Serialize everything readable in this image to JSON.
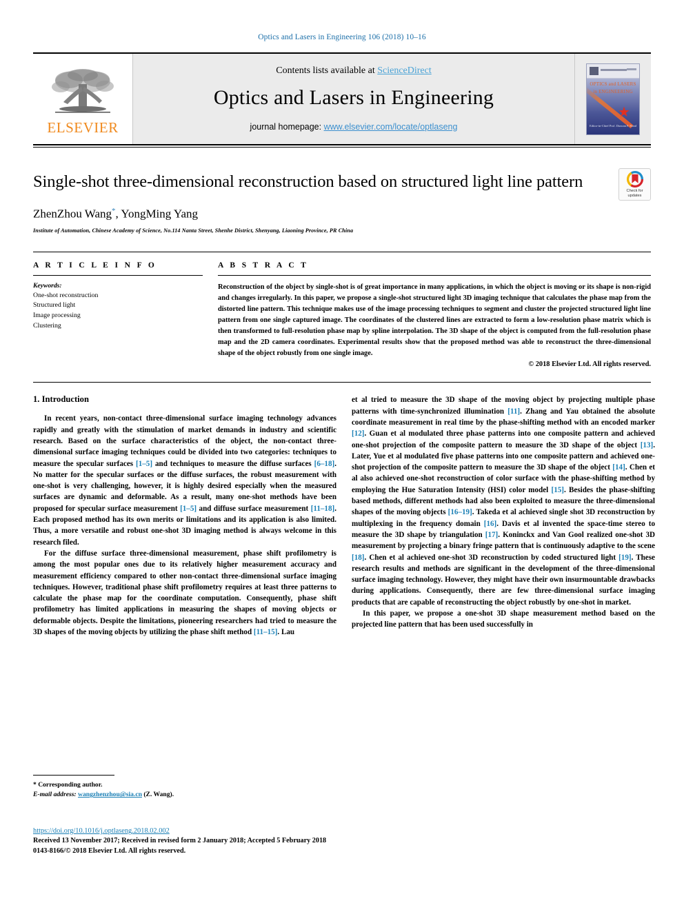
{
  "running_head": "Optics and Lasers in Engineering 106 (2018) 10–16",
  "masthead": {
    "publisher_name": "ELSEVIER",
    "publisher_logo": "elsevier-tree-logo",
    "contents_prefix": "Contents lists available at ",
    "contents_link": "ScienceDirect",
    "journal_name": "Optics and Lasers in Engineering",
    "homepage_prefix": "journal homepage: ",
    "homepage_link": "www.elsevier.com/locate/optlaseng",
    "cover": {
      "title_line1": "OPTICS and LASERS",
      "title_line2": "in ENGINEERING",
      "bottom_text": "Editor-in-Chief\nProf. Duncan P. Hand"
    }
  },
  "article": {
    "title": "Single-shot three-dimensional reconstruction based on structured light line pattern",
    "authors": "ZhenZhou Wang",
    "authors_rest": ", YongMing Yang",
    "corresponding_marker": "*",
    "affiliation": "Institute of Automation, Chinese Academy of Science, No.114 Nanta Street, Shenhe District, Shenyang, Liaoning Province, PR China",
    "crossmark": {
      "line1": "Check for",
      "line2": "updates"
    }
  },
  "article_info": {
    "heading": "A R T I C L E   I N F O",
    "keywords_label": "Keywords:",
    "keywords": [
      "One-shot reconstruction",
      "Structured light",
      "Image processing",
      "Clustering"
    ]
  },
  "abstract": {
    "heading": "A B S T R A C T",
    "text": "Reconstruction of the object by single-shot is of great importance in many applications, in which the object is moving or its shape is non-rigid and changes irregularly. In this paper, we propose a single-shot structured light 3D imaging technique that calculates the phase map from the distorted line pattern. This technique makes use of the image processing techniques to segment and cluster the projected structured light line pattern from one single captured image. The coordinates of the clustered lines are extracted to form a low-resolution phase matrix which is then transformed to full-resolution phase map by spline interpolation. The 3D shape of the object is computed from the full-resolution phase map and the 2D camera coordinates. Experimental results show that the proposed method was able to reconstruct the three-dimensional shape of the object robustly from one single image.",
    "copyright": "© 2018 Elsevier Ltd. All rights reserved."
  },
  "body": {
    "section_title": "1. Introduction",
    "left_paragraphs": [
      {
        "parts": [
          {
            "t": "In recent years, non-contact three-dimensional surface imaging technology advances rapidly and greatly with the stimulation of market demands in industry and scientific research. Based on the surface characteristics of the object, the non-contact three-dimensional surface imaging techniques could be divided into two categories: techniques to measure the specular surfaces "
          },
          {
            "t": "[1–5]",
            "ref": true
          },
          {
            "t": " and techniques to measure the diffuse surfaces "
          },
          {
            "t": "[6–18]",
            "ref": true
          },
          {
            "t": ". No matter for the specular surfaces or the diffuse surfaces, the robust measurement with one-shot is very challenging, however, it is highly desired especially when the measured surfaces are dynamic and deformable. As a result, many one-shot methods have been proposed for specular surface measurement "
          },
          {
            "t": "[1–5]",
            "ref": true
          },
          {
            "t": " and diffuse surface measurement "
          },
          {
            "t": "[11–18]",
            "ref": true
          },
          {
            "t": ". Each proposed method has its own merits or limitations and its application is also limited. Thus, a more versatile and robust one-shot 3D imaging method is always welcome in this research filed."
          }
        ]
      },
      {
        "parts": [
          {
            "t": "For the diffuse surface three-dimensional measurement, phase shift profilometry is among the most popular ones due to its relatively higher measurement accuracy and measurement efficiency compared to other non-contact three-dimensional surface imaging techniques. However, traditional phase shift profilometry requires at least three patterns to calculate the phase map for the coordinate computation. Consequently, phase shift profilometry has limited applications in measuring the shapes of moving objects or deformable objects. Despite the limitations, pioneering researchers had tried to measure the 3D shapes of the moving objects by utilizing the phase shift method "
          },
          {
            "t": "[11–15]",
            "ref": true
          },
          {
            "t": ". Lau"
          }
        ]
      }
    ],
    "right_paragraphs": [
      {
        "noindent": true,
        "parts": [
          {
            "t": "et al tried to measure the 3D shape of the moving object by projecting multiple phase patterns with time-synchronized illumination "
          },
          {
            "t": "[11]",
            "ref": true
          },
          {
            "t": ". Zhang and Yau obtained the absolute coordinate measurement in real time by the phase-shifting method with an encoded marker "
          },
          {
            "t": "[12]",
            "ref": true
          },
          {
            "t": ". Guan et al modulated three phase patterns into one composite pattern and achieved one-shot projection of the composite pattern to measure the 3D shape of the object "
          },
          {
            "t": "[13]",
            "ref": true
          },
          {
            "t": ". Later, Yue et al modulated five phase patterns into one composite pattern and achieved one-shot projection of the composite pattern to measure the 3D shape of the object "
          },
          {
            "t": "[14]",
            "ref": true
          },
          {
            "t": ". Chen et al also achieved one-shot reconstruction of color surface with the phase-shifting method by employing the Hue Saturation Intensity (HSI) color model "
          },
          {
            "t": "[15]",
            "ref": true
          },
          {
            "t": ". Besides the phase-shifting based methods, different methods had also been exploited to measure the three-dimensional shapes of the moving objects "
          },
          {
            "t": "[16–19]",
            "ref": true
          },
          {
            "t": ". Takeda et al achieved single shot 3D reconstruction by multiplexing in the frequency domain "
          },
          {
            "t": "[16]",
            "ref": true
          },
          {
            "t": ". Davis et al invented the space-time stereo to measure the 3D shape by triangulation "
          },
          {
            "t": "[17]",
            "ref": true
          },
          {
            "t": ". Koninckx and Van Gool realized one-shot 3D measurement by projecting a binary fringe pattern that is continuously adaptive to the scene "
          },
          {
            "t": "[18]",
            "ref": true
          },
          {
            "t": ". Chen et al achieved one-shot 3D reconstruction by coded structured light "
          },
          {
            "t": "[19]",
            "ref": true
          },
          {
            "t": ". These research results and methods are significant in the development of the three-dimensional surface imaging technology. However, they might have their own insurmountable drawbacks during applications. Consequently, there are few three-dimensional surface imaging products that are capable of reconstructing the object robustly by one-shot in market."
          }
        ]
      },
      {
        "parts": [
          {
            "t": "In this paper, we propose a one-shot 3D shape measurement method based on the projected line pattern that has been used successfully in"
          }
        ]
      }
    ]
  },
  "footnote": {
    "corresponding": "* Corresponding author.",
    "email_label": "E-mail address:",
    "email": "wangzhenzhou@sia.cn",
    "email_suffix": "(Z. Wang)."
  },
  "footer": {
    "doi": "https://doi.org/10.1016/j.optlaseng.2018.02.002",
    "history": "Received 13 November 2017; Received in revised form 2 January 2018; Accepted 5 February 2018",
    "issn": "0143-8166/© 2018 Elsevier Ltd. All rights reserved."
  },
  "colors": {
    "link_blue": "#1a7fb5",
    "sciencedirect_blue": "#4aa3d6",
    "elsevier_orange": "#f08a1e",
    "running_head_blue": "#1a6ea8"
  }
}
